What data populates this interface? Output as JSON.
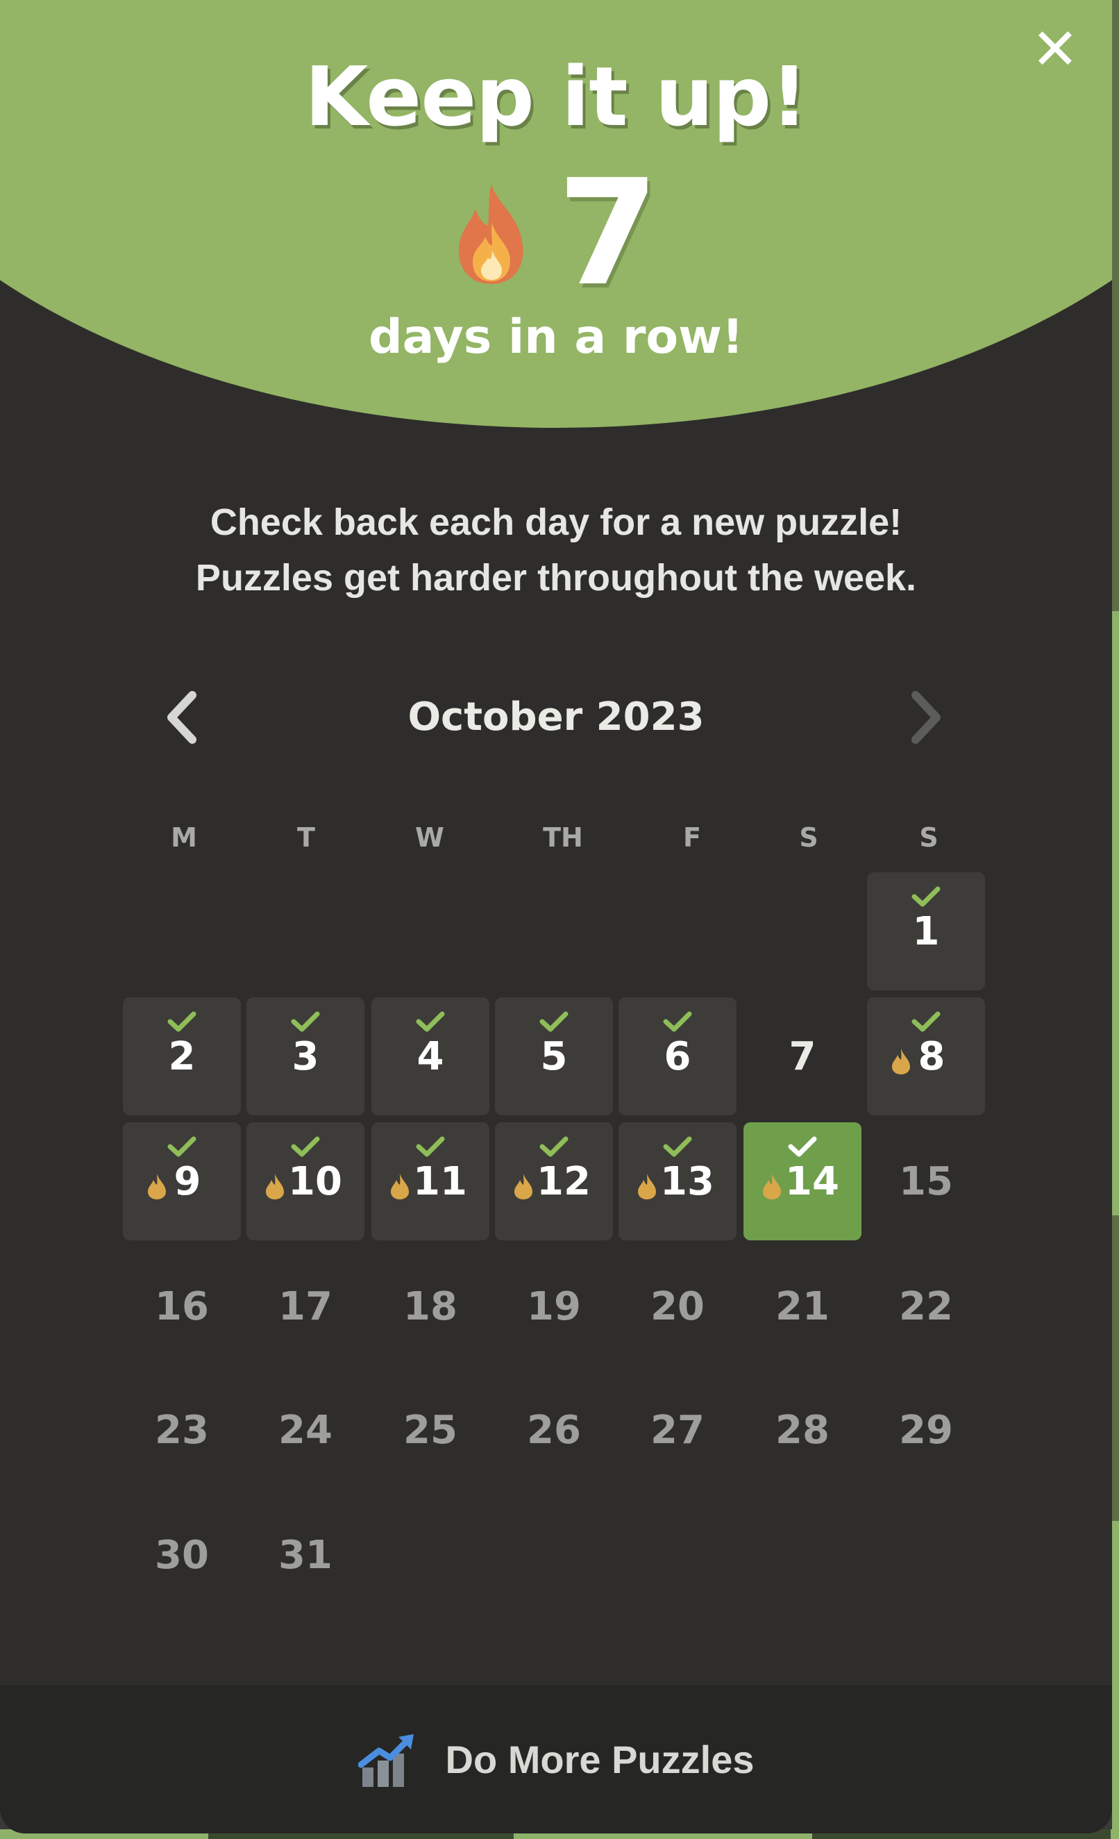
{
  "header": {
    "title": "Keep it up!",
    "streak_count": "7",
    "streak_label": "days in a row!",
    "close_symbol": "✕"
  },
  "message": {
    "line1": "Check back each day for a new puzzle!",
    "line2": "Puzzles get harder throughout the week."
  },
  "calendar": {
    "month_label": "October 2023",
    "weekdays": [
      "M",
      "T",
      "W",
      "TH",
      "F",
      "S",
      "S"
    ],
    "days": [
      {
        "num": "1",
        "status": "played",
        "flame": false
      },
      {
        "num": "2",
        "status": "played",
        "flame": false
      },
      {
        "num": "3",
        "status": "played",
        "flame": false
      },
      {
        "num": "4",
        "status": "played",
        "flame": false
      },
      {
        "num": "5",
        "status": "played",
        "flame": false
      },
      {
        "num": "6",
        "status": "played",
        "flame": false
      },
      {
        "num": "7",
        "status": "missed",
        "flame": false
      },
      {
        "num": "8",
        "status": "played",
        "flame": true
      },
      {
        "num": "9",
        "status": "played",
        "flame": true
      },
      {
        "num": "10",
        "status": "played",
        "flame": true
      },
      {
        "num": "11",
        "status": "played",
        "flame": true
      },
      {
        "num": "12",
        "status": "played",
        "flame": true
      },
      {
        "num": "13",
        "status": "played",
        "flame": true
      },
      {
        "num": "14",
        "status": "today",
        "flame": true
      },
      {
        "num": "15",
        "status": "future",
        "flame": false
      },
      {
        "num": "16",
        "status": "future",
        "flame": false
      },
      {
        "num": "17",
        "status": "future",
        "flame": false
      },
      {
        "num": "18",
        "status": "future",
        "flame": false
      },
      {
        "num": "19",
        "status": "future",
        "flame": false
      },
      {
        "num": "20",
        "status": "future",
        "flame": false
      },
      {
        "num": "21",
        "status": "future",
        "flame": false
      },
      {
        "num": "22",
        "status": "future",
        "flame": false
      },
      {
        "num": "23",
        "status": "future",
        "flame": false
      },
      {
        "num": "24",
        "status": "future",
        "flame": false
      },
      {
        "num": "25",
        "status": "future",
        "flame": false
      },
      {
        "num": "26",
        "status": "future",
        "flame": false
      },
      {
        "num": "27",
        "status": "future",
        "flame": false
      },
      {
        "num": "28",
        "status": "future",
        "flame": false
      },
      {
        "num": "29",
        "status": "future",
        "flame": false
      },
      {
        "num": "30",
        "status": "future",
        "flame": false
      },
      {
        "num": "31",
        "status": "future",
        "flame": false
      }
    ]
  },
  "footer": {
    "label": "Do More Puzzles",
    "icon": "chart-increasing-icon"
  },
  "colors": {
    "header_green": "#93b565",
    "today_green": "#6f9f4b",
    "check_green": "#8fbd58",
    "modal_bg": "#2e2d2b",
    "played_cell": "#3d3c39",
    "flame_gold": "#d9a64a"
  }
}
